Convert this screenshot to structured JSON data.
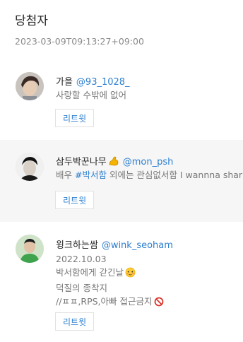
{
  "header": {
    "title": "당첨자",
    "timestamp": "2023-03-09T09:13:27+09:00"
  },
  "winners": [
    {
      "name": "가을",
      "handle": "@93_1028_",
      "bio_lines": [
        "사랑할 수밖에 없어"
      ],
      "retweet_label": "리트윗"
    },
    {
      "name": "삼두박꾼나무",
      "name_emoji": "flexed-biceps",
      "handle": "@mon_psh",
      "bio_prefix": "배우 ",
      "bio_tag": "#박서함",
      "bio_suffix": " 외에는 관심없서함 I wannna shar",
      "retweet_label": "리트윗"
    },
    {
      "name": "윙크하는쌈",
      "handle": "@wink_seoham",
      "bio_lines": [
        "2022.10.03",
        "박서함에게 갇긴날",
        "덕질의 종착지",
        "//ㅍㅍ,RPS,아빠 접근금지"
      ],
      "retweet_label": "리트윗"
    }
  ]
}
